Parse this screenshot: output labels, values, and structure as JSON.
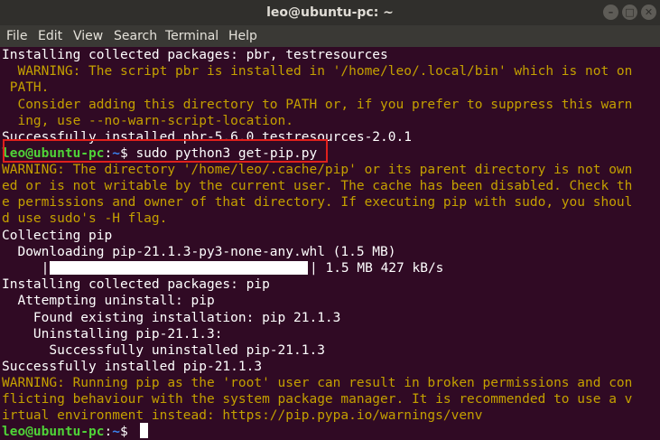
{
  "window": {
    "title": "leo@ubuntu-pc: ~"
  },
  "window_controls": {
    "minimize": "–",
    "maximize": "□",
    "close": "✕"
  },
  "menu": [
    "File",
    "Edit",
    "View",
    "Search",
    "Terminal",
    "Help"
  ],
  "terminal": {
    "lines": [
      "Installing collected packages: pbr, testresources",
      "  WARNING: The script pbr is installed in '/home/leo/.local/bin' which is not on",
      " PATH.",
      "  Consider adding this directory to PATH or, if you prefer to suppress this warn",
      "  ing, use --no-warn-script-location.",
      "Successfully installed pbr-5.6.0 testresources-2.0.1",
      "WARNING: The directory '/home/leo/.cache/pip' or its parent directory is not own",
      "ed or is not writable by the current user. The cache has been disabled. Check th",
      "e permissions and owner of that directory. If executing pip with sudo, you shoul",
      "d use sudo's -H flag.",
      "Collecting pip",
      "  Downloading pip-21.1.3-py3-none-any.whl (1.5 MB)",
      "| 1.5 MB 427 kB/s",
      "Installing collected packages: pip",
      "  Attempting uninstall: pip",
      "    Found existing installation: pip 21.1.3",
      "    Uninstalling pip-21.1.3:",
      "      Successfully uninstalled pip-21.1.3",
      "Successfully installed pip-21.1.3",
      "WARNING: Running pip as the 'root' user can result in broken permissions and con",
      "flicting behaviour with the system package manager. It is recommended to use a v",
      "irtual environment instead: https://pip.pypa.io/warnings/venv"
    ],
    "prompt_user": "leo@ubuntu-pc",
    "prompt_sep": ":",
    "prompt_path": "~",
    "prompt_symbol": "$ ",
    "command": "sudo python3 get-pip.py",
    "progress_fraction": 1.0
  }
}
